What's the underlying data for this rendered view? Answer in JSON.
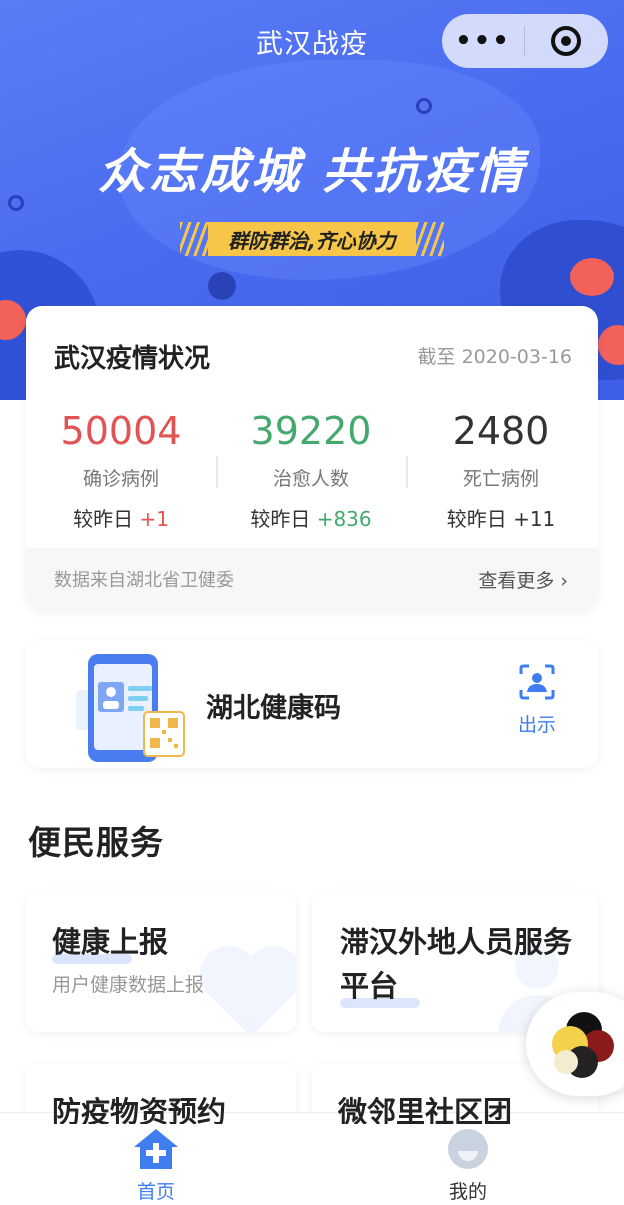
{
  "nav": {
    "title": "武汉战疫",
    "more_label": "•••"
  },
  "banner": {
    "slogan": "众志成城 共抗疫情",
    "sub_slogan": "群防群治,齐心协力"
  },
  "status_card": {
    "title": "武汉疫情状况",
    "date": "截至 2020-03-16",
    "stats": [
      {
        "value": "50004",
        "label": "确诊病例",
        "delta_prefix": "较昨日 ",
        "delta": "+1"
      },
      {
        "value": "39220",
        "label": "治愈人数",
        "delta_prefix": "较昨日 ",
        "delta": "+836"
      },
      {
        "value": "2480",
        "label": "死亡病例",
        "delta_prefix": "较昨日 ",
        "delta": "+11"
      }
    ],
    "source": "数据来自湖北省卫健委",
    "more_link": "查看更多"
  },
  "health_code": {
    "title": "湖北健康码",
    "show_label": "出示"
  },
  "services": {
    "title": "便民服务",
    "items": [
      {
        "title": "健康上报",
        "desc": "用户健康数据上报"
      },
      {
        "title": "滞汉外地人员服务平台",
        "desc": ""
      },
      {
        "title": "防疫物资预约",
        "desc": ""
      },
      {
        "title": "微邻里社区团",
        "desc": ""
      }
    ]
  },
  "tabbar": {
    "home": "首页",
    "me": "我的"
  },
  "colors": {
    "accent": "#3e7ef0",
    "confirmed": "#e25353",
    "cured": "#45a86c",
    "banner": "#4a6cf0",
    "highlight": "#f7c548"
  }
}
